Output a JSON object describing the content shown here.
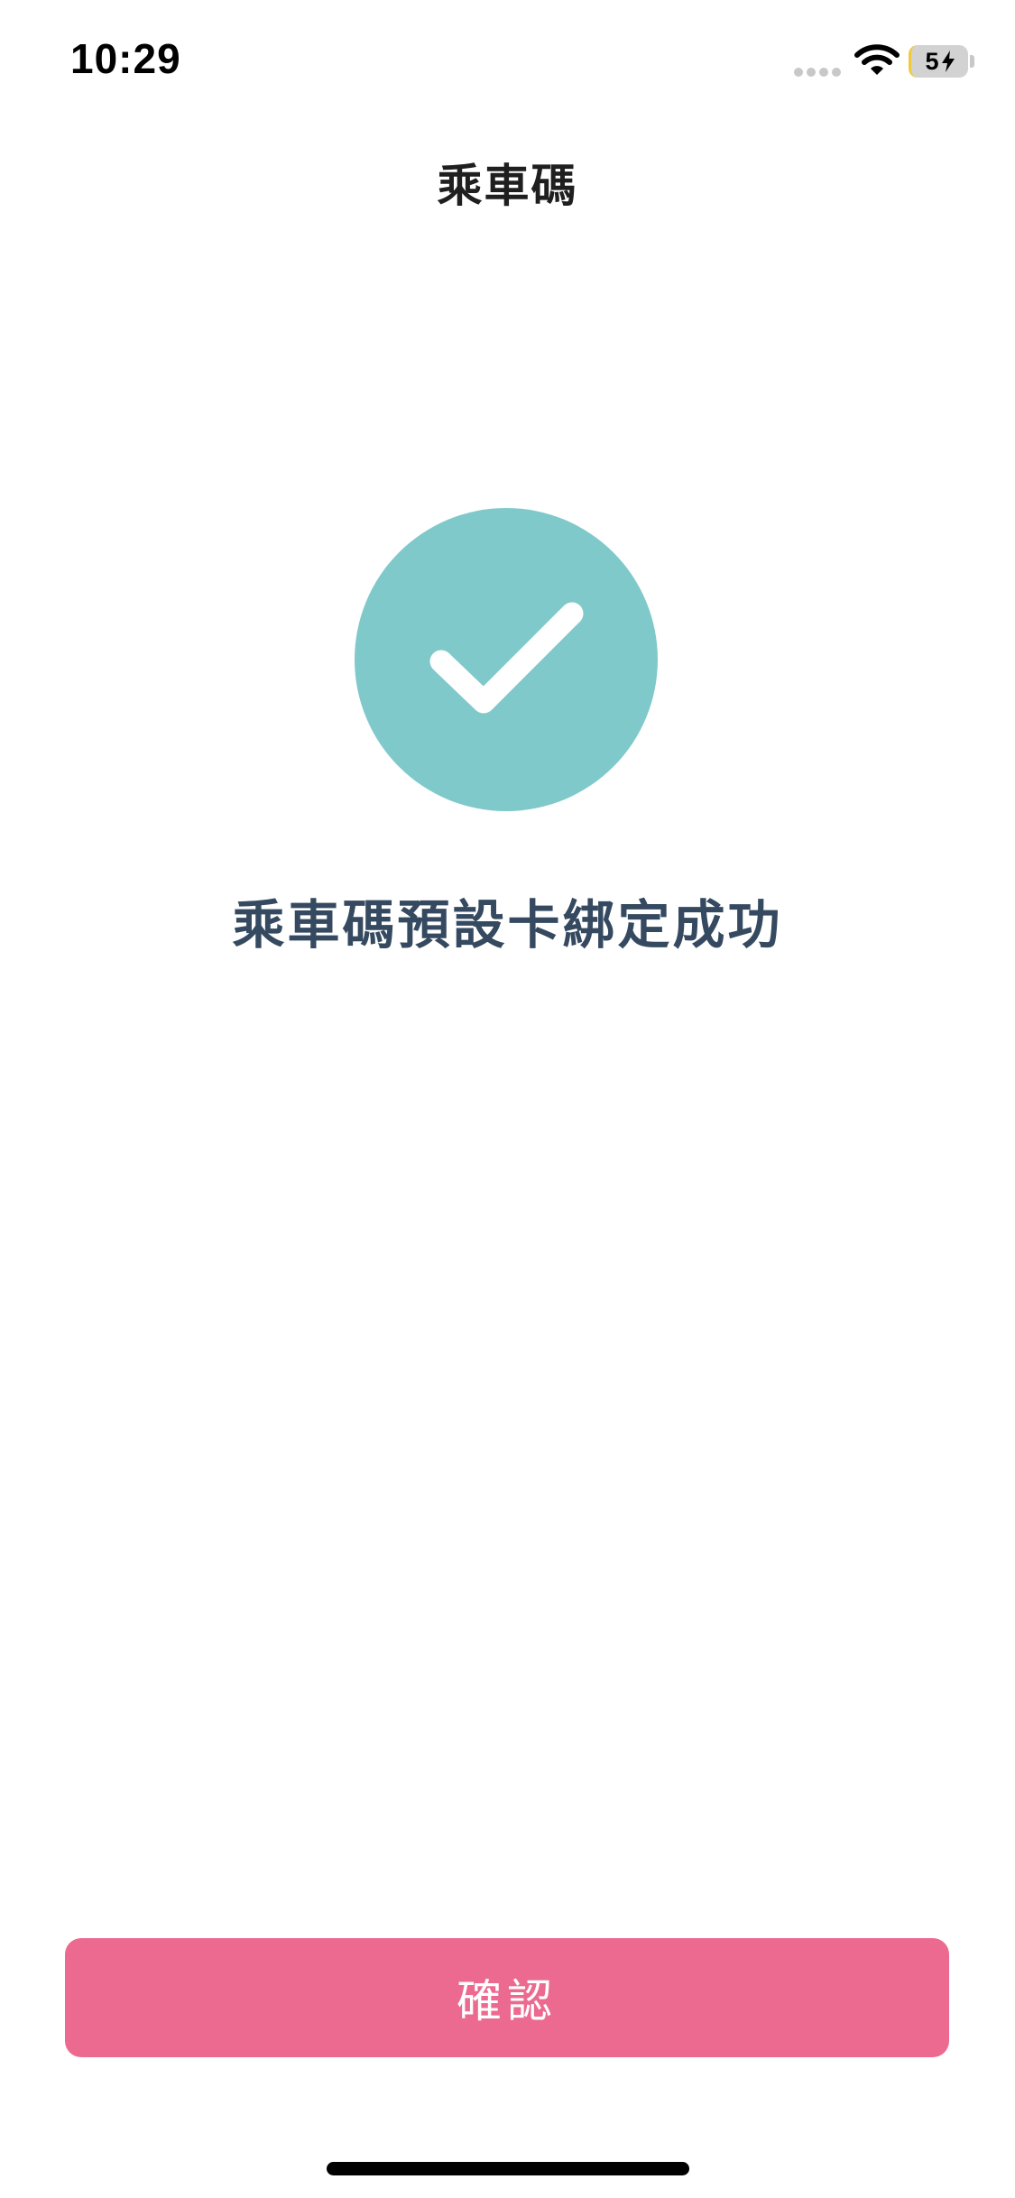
{
  "status_bar": {
    "time": "10:29",
    "battery_level": "5",
    "icons": [
      "signal-dots-icon",
      "wifi-icon",
      "battery-icon",
      "charging-bolt-icon"
    ]
  },
  "header": {
    "title": "乘車碼"
  },
  "main": {
    "status_icon": "checkmark-circle-icon",
    "message": "乘車碼預設卡綁定成功"
  },
  "footer": {
    "confirm_label": "確認"
  },
  "colors": {
    "success_circle": "#80c9cb",
    "message_text": "#354a60",
    "confirm_button": "#ec6a90",
    "battery_indicator": "#f0c93c"
  }
}
